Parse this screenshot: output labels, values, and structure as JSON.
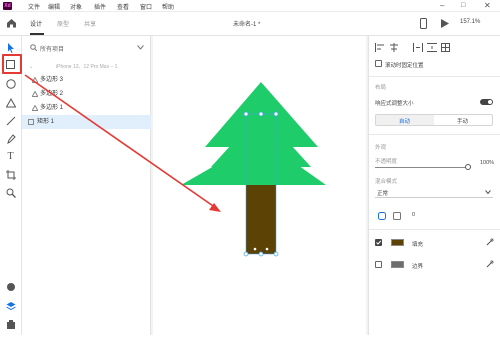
{
  "app": {
    "logo": "Xd"
  },
  "menu": [
    "文件",
    "编辑",
    "对象",
    "插件",
    "查看",
    "窗口",
    "帮助"
  ],
  "tabs": {
    "design": "设计",
    "prototype": "原型",
    "share": "共享"
  },
  "document": {
    "title": "未命名-1 *"
  },
  "zoom": "157.1%",
  "layers": {
    "search_label": "所有项目",
    "artboard": "iPhone 13、12 Pro Max – 1",
    "items": [
      "多边形 3",
      "多边形 2",
      "多边形 1",
      "矩形 1"
    ],
    "selected_index": 3
  },
  "right_panel": {
    "fix_position": "滚动时固定位置",
    "layout_heading": "布局",
    "responsive_resize": "响应式调整大小",
    "responsive_on": true,
    "mode_auto": "自动",
    "mode_manual": "手动",
    "appearance_heading": "外观",
    "opacity_label": "不透明度",
    "opacity_value": "100%",
    "blend_label": "混合模式",
    "blend_value": "正常",
    "radius_value": "0",
    "fill_label": "填充",
    "fill_checked": true,
    "fill_color": "#5c4305",
    "border_label": "边界",
    "border_checked": false,
    "border_color": "#6d6d6d"
  },
  "colors": {
    "tree_green": "#1fcc6a",
    "trunk_brown": "#5c4305",
    "highlight_red": "#e53935",
    "selection_blue": "#3aa0ef"
  }
}
